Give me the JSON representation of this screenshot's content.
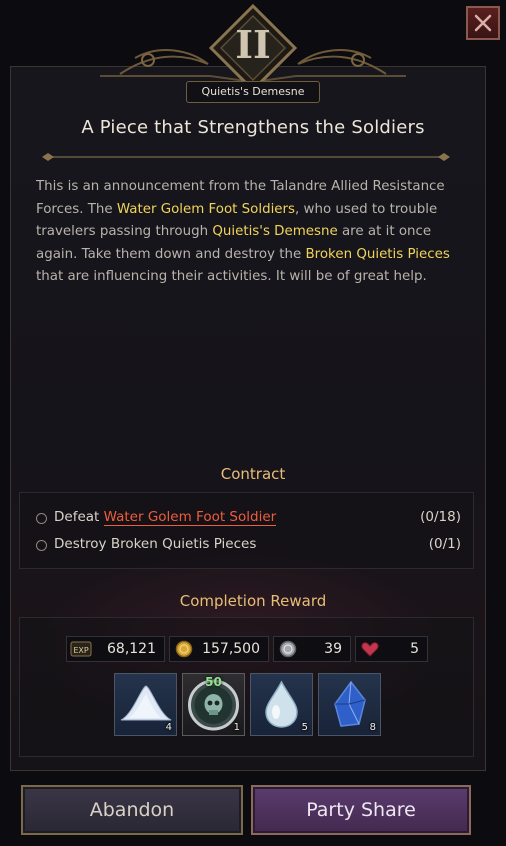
{
  "header": {
    "chapter_numeral": "II",
    "region": "Quietis's Demesne",
    "close_icon": "close-x-icon"
  },
  "quest": {
    "title": "A Piece that Strengthens the Soldiers",
    "description": {
      "p1": "This is an announcement from the Talandre Allied Resistance Forces. The ",
      "h1": "Water Golem Foot Soldiers",
      "p2": ", who used to trouble travelers passing through ",
      "h2": "Quietis's Demesne",
      "p3": " are at it once again. Take them down and destroy the ",
      "h3": "Broken Quietis Pieces",
      "p4": " that are influencing their activities. It will be of great help."
    }
  },
  "contract": {
    "title": "Contract",
    "objectives": [
      {
        "prefix": "Defeat ",
        "target": "Water Golem Foot Soldier",
        "progress": "(0/18)"
      },
      {
        "prefix": "Destroy Broken Quietis Pieces",
        "target": "",
        "progress": "(0/1)"
      }
    ]
  },
  "rewards": {
    "title": "Completion Reward",
    "stats": [
      {
        "icon": "exp-icon",
        "value": "68,121"
      },
      {
        "icon": "gold-coin-icon",
        "value": "157,500"
      },
      {
        "icon": "silver-coin-icon",
        "value": "39"
      },
      {
        "icon": "heart-gem-icon",
        "value": "5"
      }
    ],
    "items": [
      {
        "icon": "powder-pile-icon",
        "quantity": "4"
      },
      {
        "icon": "skull-orb-icon",
        "quantity": "1",
        "level": "50"
      },
      {
        "icon": "water-drop-icon",
        "quantity": "5"
      },
      {
        "icon": "blue-crystal-icon",
        "quantity": "8"
      }
    ]
  },
  "actions": {
    "abandon_label": "Abandon",
    "party_share_label": "Party Share"
  },
  "colors": {
    "highlight": "#f0d45a",
    "target_red": "#ee5d3e",
    "section_title": "#e8bd78",
    "objective_level": "#8fe38c"
  }
}
